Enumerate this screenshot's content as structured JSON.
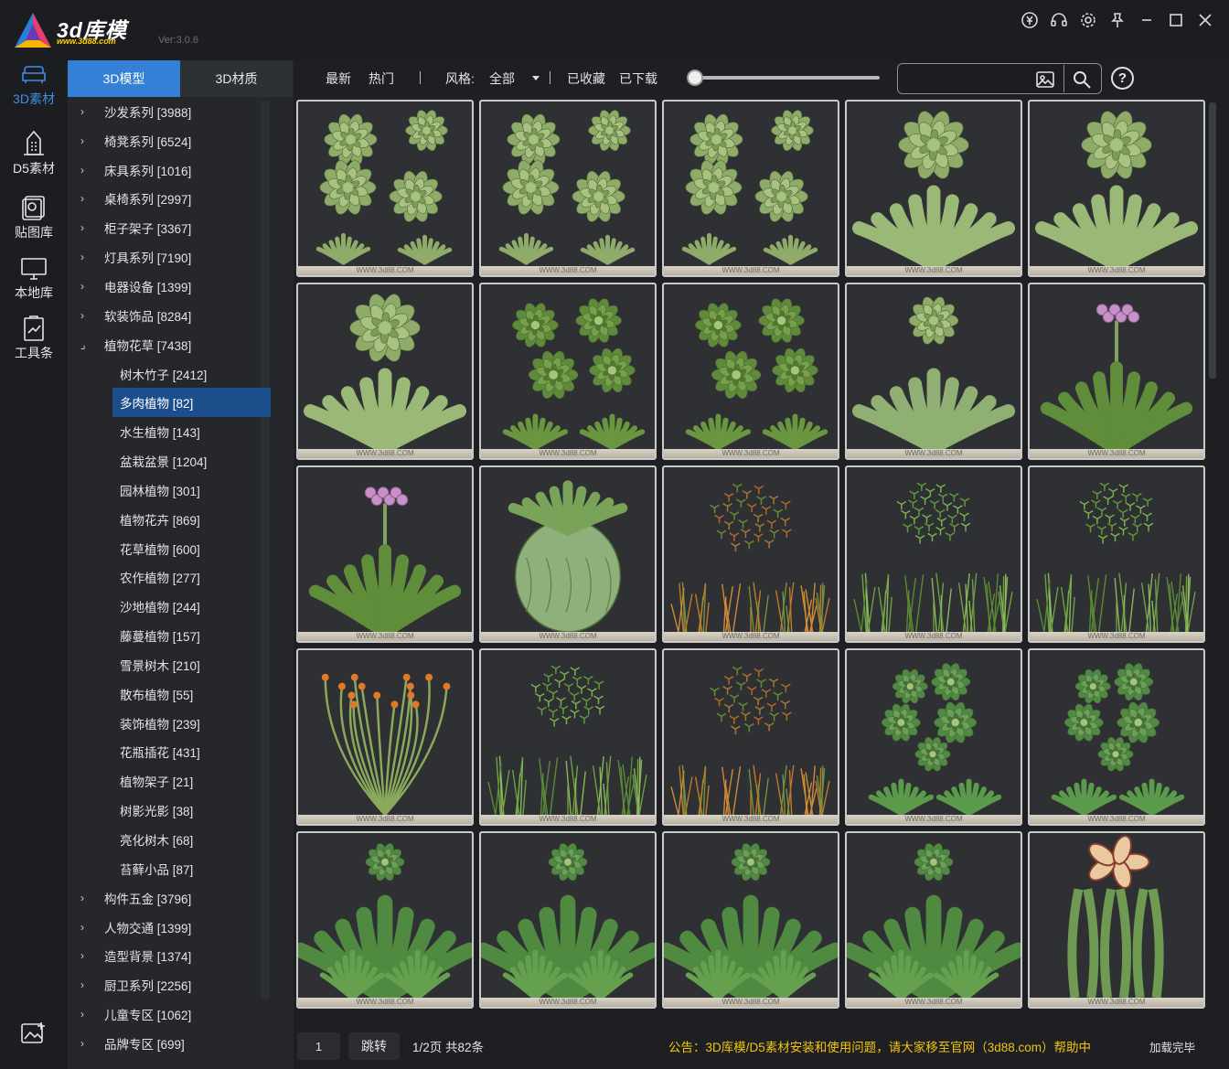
{
  "app": {
    "logo_text": "3d库模",
    "logo_url": "www.3d88.com",
    "version": "Ver:3.0.6"
  },
  "window_controls": [
    "coin-icon",
    "headset-icon",
    "gear-icon",
    "pin-icon",
    "minimize-icon",
    "maximize-icon",
    "close-icon"
  ],
  "rail": [
    {
      "label": "3D素材",
      "icon": "sofa-icon",
      "active": true
    },
    {
      "label": "D5素材",
      "icon": "building-icon",
      "active": false
    },
    {
      "label": "贴图库",
      "icon": "texture-icon",
      "active": false
    },
    {
      "label": "本地库",
      "icon": "monitor-icon",
      "active": false
    },
    {
      "label": "工具条",
      "icon": "clipboard-icon",
      "active": false
    }
  ],
  "rail_bottom_icon": "image-add-icon",
  "category_tabs": [
    {
      "label": "3D模型",
      "active": true
    },
    {
      "label": "3D材质",
      "active": false
    }
  ],
  "categories": [
    {
      "label": "沙发系列 [3988]",
      "level": 0,
      "arrow": "›"
    },
    {
      "label": "椅凳系列 [6524]",
      "level": 0,
      "arrow": "›"
    },
    {
      "label": "床具系列 [1016]",
      "level": 0,
      "arrow": "›"
    },
    {
      "label": "桌椅系列 [2997]",
      "level": 0,
      "arrow": "›"
    },
    {
      "label": "柜子架子 [3367]",
      "level": 0,
      "arrow": "›"
    },
    {
      "label": "灯具系列 [7190]",
      "level": 0,
      "arrow": "›"
    },
    {
      "label": "电器设备 [1399]",
      "level": 0,
      "arrow": "›"
    },
    {
      "label": "软装饰品 [8284]",
      "level": 0,
      "arrow": "›"
    },
    {
      "label": "植物花草 [7438]",
      "level": 0,
      "arrow": "⌟"
    },
    {
      "label": "树木竹子 [2412]",
      "level": 1
    },
    {
      "label": "多肉植物 [82]",
      "level": 1,
      "selected": true
    },
    {
      "label": "水生植物 [143]",
      "level": 1
    },
    {
      "label": "盆栽盆景 [1204]",
      "level": 1
    },
    {
      "label": "园林植物 [301]",
      "level": 1
    },
    {
      "label": "植物花卉 [869]",
      "level": 1
    },
    {
      "label": "花草植物 [600]",
      "level": 1
    },
    {
      "label": "农作植物 [277]",
      "level": 1
    },
    {
      "label": "沙地植物 [244]",
      "level": 1
    },
    {
      "label": "藤蔓植物 [157]",
      "level": 1
    },
    {
      "label": "雪景树木 [210]",
      "level": 1
    },
    {
      "label": "散布植物 [55]",
      "level": 1
    },
    {
      "label": "装饰植物 [239]",
      "level": 1
    },
    {
      "label": "花瓶插花 [431]",
      "level": 1
    },
    {
      "label": "植物架子 [21]",
      "level": 1
    },
    {
      "label": "树影光影 [38]",
      "level": 1
    },
    {
      "label": "亮化树木 [68]",
      "level": 1
    },
    {
      "label": "苔藓小品 [87]",
      "level": 1
    },
    {
      "label": "构件五金 [3796]",
      "level": 0,
      "arrow": "›"
    },
    {
      "label": "人物交通 [1399]",
      "level": 0,
      "arrow": "›"
    },
    {
      "label": "造型背景 [1374]",
      "level": 0,
      "arrow": "›"
    },
    {
      "label": "厨卫系列 [2256]",
      "level": 0,
      "arrow": "›"
    },
    {
      "label": "儿童专区 [1062]",
      "level": 0,
      "arrow": "›"
    },
    {
      "label": "品牌专区 [699]",
      "level": 0,
      "arrow": "›"
    }
  ],
  "toolbar": {
    "newest": "最新",
    "popular": "热门",
    "style_label": "风格:",
    "style_value": "全部",
    "favorites": "已收藏",
    "downloaded": "已下载",
    "search_placeholder": "",
    "help": "?"
  },
  "thumbnails": {
    "watermark": "WWW.3d88.COM",
    "items": [
      "rosette-scatter",
      "rosette-scatter",
      "rosette-scatter",
      "rosette-big",
      "rosette-big",
      "rosette-big",
      "star-scatter",
      "star-scatter",
      "agave-flower",
      "aloe-flower",
      "aloe-flower",
      "artichoke",
      "bush-orange",
      "bush-green",
      "bush-green",
      "coral-orange",
      "bush-green",
      "bush-orange",
      "echeveria-cluster",
      "echeveria-cluster",
      "haworthia",
      "haworthia",
      "haworthia",
      "haworthia",
      "stapelia"
    ]
  },
  "footer": {
    "page_input": "1",
    "jump": "跳转",
    "page_info": "1/2页 共82条",
    "notice": "公告：3D库模/D5素材安装和使用问题，请大家移至官网（3d88.com）帮助中",
    "load_status": "加载完毕"
  }
}
